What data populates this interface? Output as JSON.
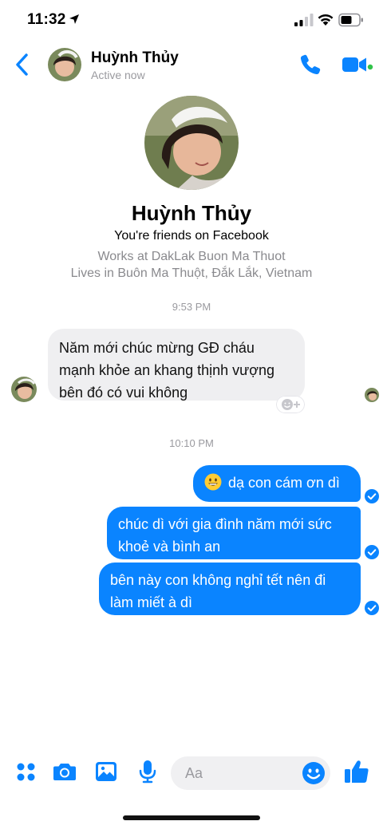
{
  "status_bar": {
    "time": "11:32"
  },
  "header": {
    "name": "Huỳnh Thủy",
    "status": "Active now"
  },
  "profile": {
    "name": "Huỳnh Thủy",
    "friends": "You're friends on Facebook",
    "work": "Works at DakLak Buon Ma Thuot",
    "lives": "Lives in Buôn Ma Thuột, Đắk Lắk, Vietnam"
  },
  "conversation": {
    "timestamp_1": "9:53 PM",
    "incoming": {
      "lines": [
        "Năm mới chúc mừng GĐ cháu",
        "mạnh khỏe an khang thịnh vượng",
        "bên đó có vui không"
      ]
    },
    "timestamp_2": "10:10 PM",
    "outgoing": [
      {
        "lines": [
          "dạ con cám ơn dì"
        ]
      },
      {
        "lines": [
          "chúc dì với gia đình năm mới sức",
          "khoẻ và bình an"
        ]
      },
      {
        "lines": [
          "bên này con không nghỉ tết nên đi",
          "làm miết à dì"
        ]
      }
    ]
  },
  "composer": {
    "placeholder": "Aa"
  },
  "colors": {
    "accent": "#0a84ff",
    "incoming_bubble": "#efeff1",
    "active_green": "#31c34a"
  }
}
